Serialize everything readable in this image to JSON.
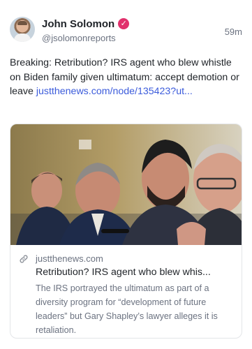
{
  "author": {
    "name": "John Solomon",
    "handle": "@jsolomonreports",
    "verified_mark": "✓",
    "verified_color": "#e1306c",
    "avatar_icon": "avatar-photo"
  },
  "post": {
    "time": "59m",
    "text_prefix": "Breaking: Retribution? IRS agent who blew whistle on Biden family given ultimatum: accept demotion or leave ",
    "link_text": "justthenews.com/node/135423?ut...",
    "link_color": "#3b5bdb"
  },
  "card": {
    "domain": "justthenews.com",
    "title": "Retribution? IRS agent who blew whis...",
    "description": "The IRS portrayed the ultimatum as part of a diversity program for “development of future leaders” but Gary Shapley’s lawyer alleges it is retaliation.",
    "link_icon": "link-icon"
  }
}
